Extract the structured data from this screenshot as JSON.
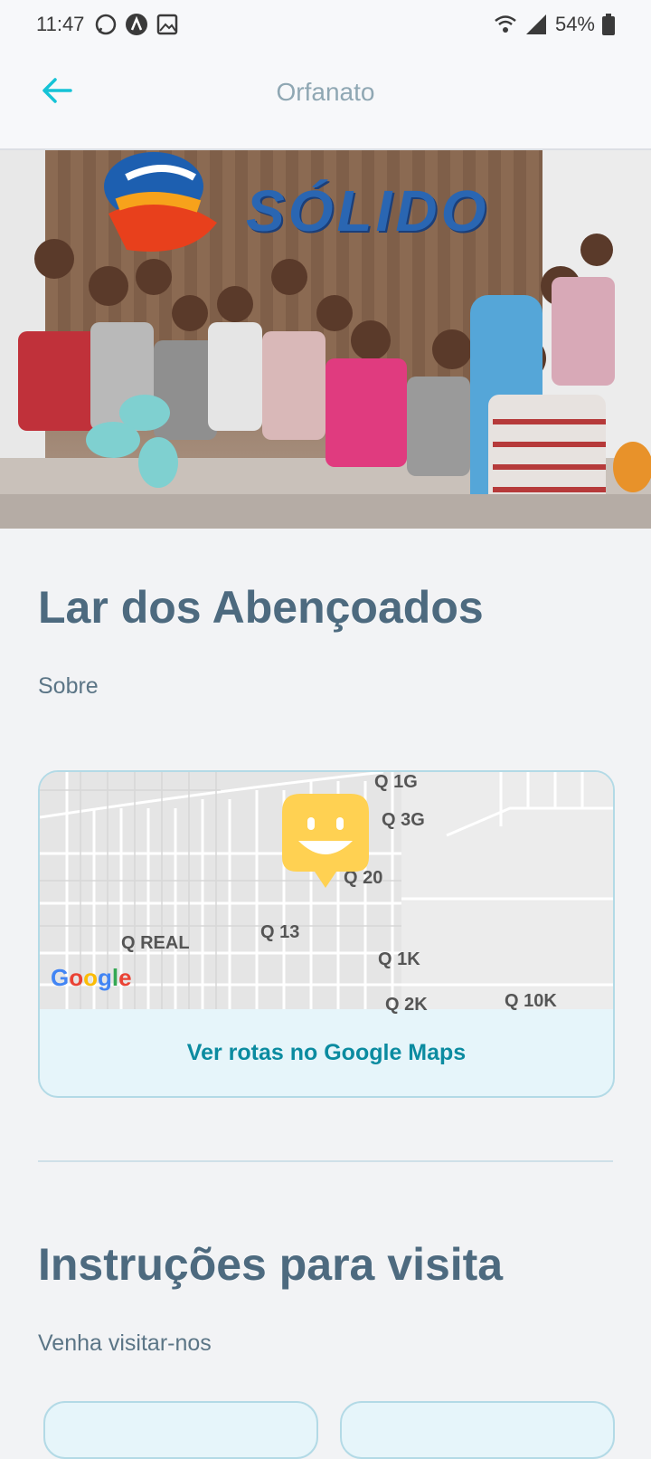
{
  "status_bar": {
    "time": "11:47",
    "battery": "54%",
    "icons": [
      "whatsapp-icon",
      "a-notification-icon",
      "image-icon",
      "wifi-icon",
      "signal-icon",
      "battery-icon"
    ]
  },
  "app_bar": {
    "title": "Orfanato",
    "back_icon": "arrow-left-icon"
  },
  "hero": {
    "wall_text": "SÓLIDO"
  },
  "orphanage": {
    "name": "Lar dos Abençoados",
    "about": "Sobre"
  },
  "map": {
    "labels": [
      "Q 1G",
      "Q 3G",
      "Q 20",
      "Q REAL",
      "Q 13",
      "Q 1K",
      "Q 2K",
      "Q 10K"
    ],
    "google_logo": "Google",
    "routes_link": "Ver rotas no Google Maps"
  },
  "instructions": {
    "title": "Instruções para visita",
    "subtitle": "Venha visitar-nos"
  },
  "colors": {
    "accent": "#15c3d6",
    "title": "#4d6a7f",
    "marker": "#ffd152",
    "link": "#0b8ba0"
  }
}
